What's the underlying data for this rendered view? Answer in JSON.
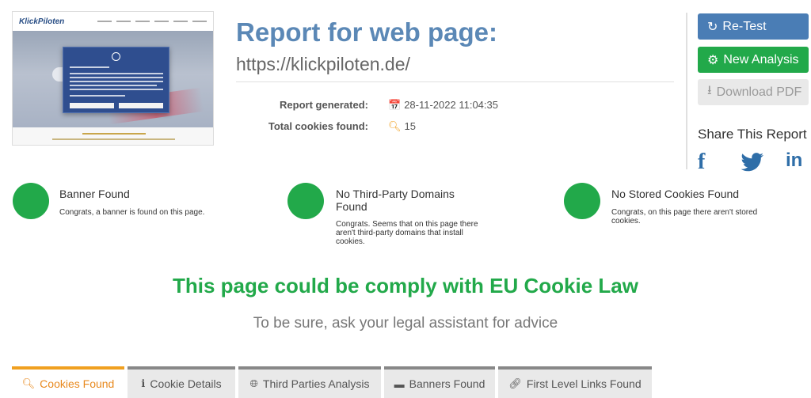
{
  "header": {
    "title": "Report for web page:",
    "url": "https://klickpiloten.de/"
  },
  "thumbnail": {
    "logo": "KlickPiloten"
  },
  "meta": {
    "generated_label": "Report generated:",
    "generated_value": "28-11-2022 11:04:35",
    "cookies_label": "Total cookies found:",
    "cookies_value": "15"
  },
  "actions": {
    "retest": "Re-Test",
    "new_analysis": "New Analysis",
    "download_pdf": "Download PDF"
  },
  "share": {
    "title": "Share This Report",
    "facebook": "f",
    "linkedin": "in"
  },
  "results": [
    {
      "title": "Banner Found",
      "desc": "Congrats, a banner is found on this page."
    },
    {
      "title": "No Third-Party Domains Found",
      "desc": "Congrats. Seems that on this page there aren't third-party domains that install cookies."
    },
    {
      "title": "No Stored Cookies Found",
      "desc": "Congrats, on this page there aren't stored cookies."
    }
  ],
  "compliance": "This page could be comply with EU Cookie Law",
  "advice": "To be sure, ask your legal assistant for advice",
  "tabs": [
    {
      "label": "Cookies Found",
      "icon": "search-icon"
    },
    {
      "label": "Cookie Details",
      "icon": "info-icon"
    },
    {
      "label": "Third Parties Analysis",
      "icon": "globe-icon"
    },
    {
      "label": "Banners Found",
      "icon": "banner-icon"
    },
    {
      "label": "First Level Links Found",
      "icon": "link-icon"
    }
  ],
  "colors": {
    "title_blue": "#5b88b6",
    "success_green": "#22a94a",
    "accent_orange": "#f0a020",
    "retest_blue": "#4a7db5"
  }
}
